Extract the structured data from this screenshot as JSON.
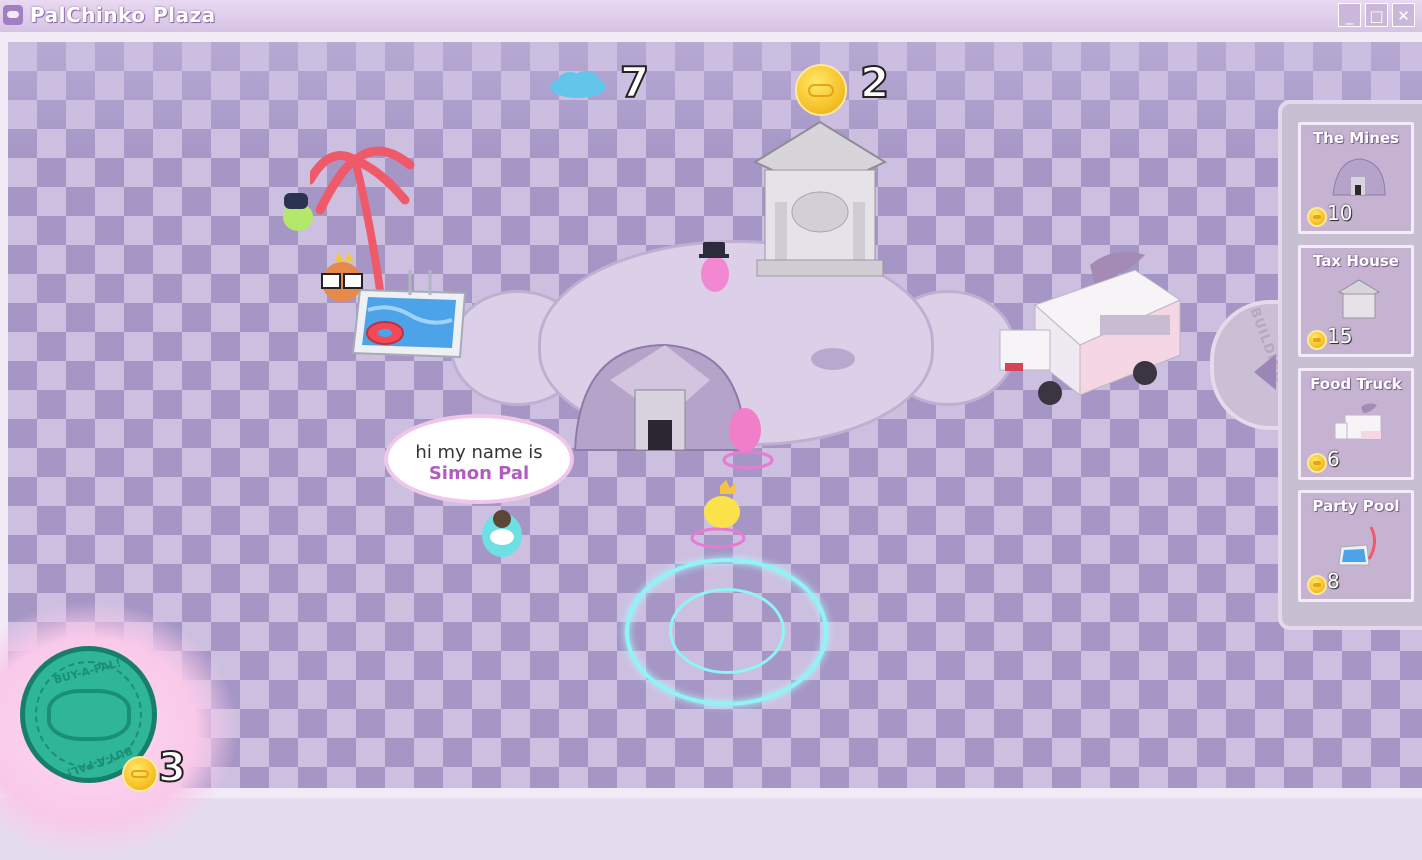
{
  "window": {
    "title": "PalChinko Plaza",
    "controls": {
      "minimize": "_",
      "maximize": "□",
      "close": "✕"
    }
  },
  "hud": {
    "clouds": "7",
    "coins": "2"
  },
  "speech_bubble": {
    "line1": "hi my name is",
    "name": "Simon Pal"
  },
  "buildings_tab": {
    "label": "BUILDINGS!"
  },
  "buildings": [
    {
      "name": "The Mines",
      "price": "10",
      "icon": "mines-dome-icon"
    },
    {
      "name": "Tax House",
      "price": "15",
      "icon": "tax-house-icon"
    },
    {
      "name": "Food Truck",
      "price": "6",
      "icon": "food-truck-icon"
    },
    {
      "name": "Party Pool",
      "price": "8",
      "icon": "party-pool-icon"
    }
  ],
  "buy_a_pal": {
    "label_top": "BUY-A-PAL!",
    "label_bottom": "BUY-A-PAL!",
    "price": "3"
  },
  "colors": {
    "checker_dark": "#a596c6",
    "checker_light": "#cdbfe0",
    "buy_button": "#2fb597",
    "name_accent": "#b05cc0",
    "rune_glow": "#8ff4f5"
  }
}
